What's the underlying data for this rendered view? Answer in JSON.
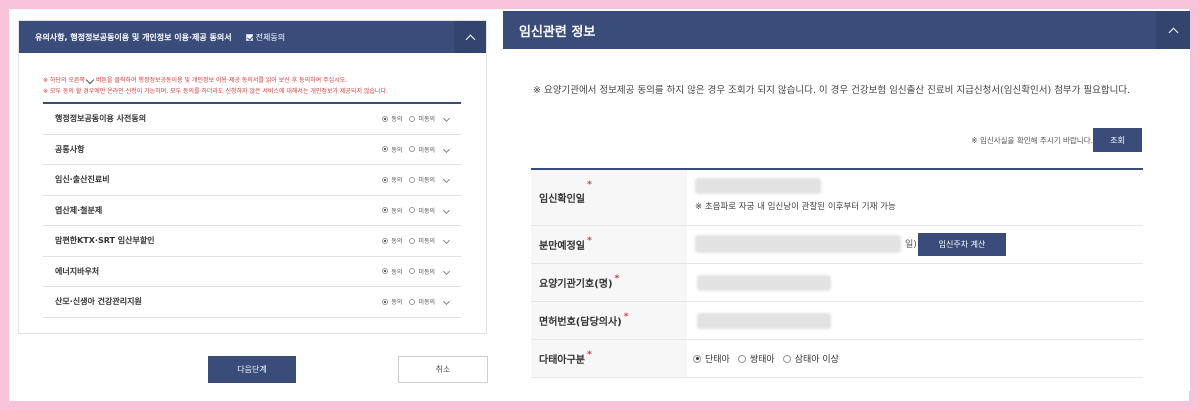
{
  "left": {
    "title": "유의사항, 행정정보공동이용 및 개인정보 이용·제공 동의서",
    "agree_all": "전체동의",
    "notice1_pre": "※ 하단의 오른쪽",
    "notice1_post": "버튼을 클릭하여 행정정보공동이용 및 개인정보 이용·제공 동의서를 읽어 보신 후 동의하여 주십시오.",
    "notice2": "※ 모두 동의 할 경우에만 온라인 신청이 가능하며, 모두 동의를 하더라도 신청하지 않은 서비스에 대해서는 개인정보가 제공되지 않습니다.",
    "agree_label": "동의",
    "disagree_label": "미동의",
    "items": [
      {
        "label": "행정정보공동이용 사전동의"
      },
      {
        "label": "공통사항"
      },
      {
        "label": "임신·출산진료비"
      },
      {
        "label": "엽산제·철분제"
      },
      {
        "label": "맘편한KTX·SRT 임산부할인"
      },
      {
        "label": "에너지바우처"
      },
      {
        "label": "산모·신생아 건강관리지원"
      }
    ],
    "next_button": "다음단계",
    "cancel_button": "취소"
  },
  "right": {
    "title": "임신관련 정보",
    "notice": "※ 요양기관에서 정보제공 동의를 하지 않은 경우 조회가 되지 않습니다. 이 경우 건강보험 임신출산 진료비 지급신청서(임신확인서) 첨부가 필요합니다.",
    "confirm_text": "※ 임신사실을 확인해 주시기 바랍니다.",
    "query_button": "조회",
    "fields": {
      "pregnancy_date": {
        "label": "임신확인일",
        "hint": "※ 초음파로 자궁 내 임신낭이 관찰된 이후부터 기재 가능"
      },
      "due_date": {
        "label": "분만예정일",
        "suffix": "일)",
        "calc_button": "임신주차 계산"
      },
      "clinic_code": {
        "label": "요양기관기호(명)"
      },
      "license_no": {
        "label": "면허번호(담당의사)"
      },
      "multiple": {
        "label": "다태아구분",
        "options": [
          "단태아",
          "쌍태아",
          "삼태아 이상"
        ]
      }
    },
    "required_mark": "*"
  }
}
